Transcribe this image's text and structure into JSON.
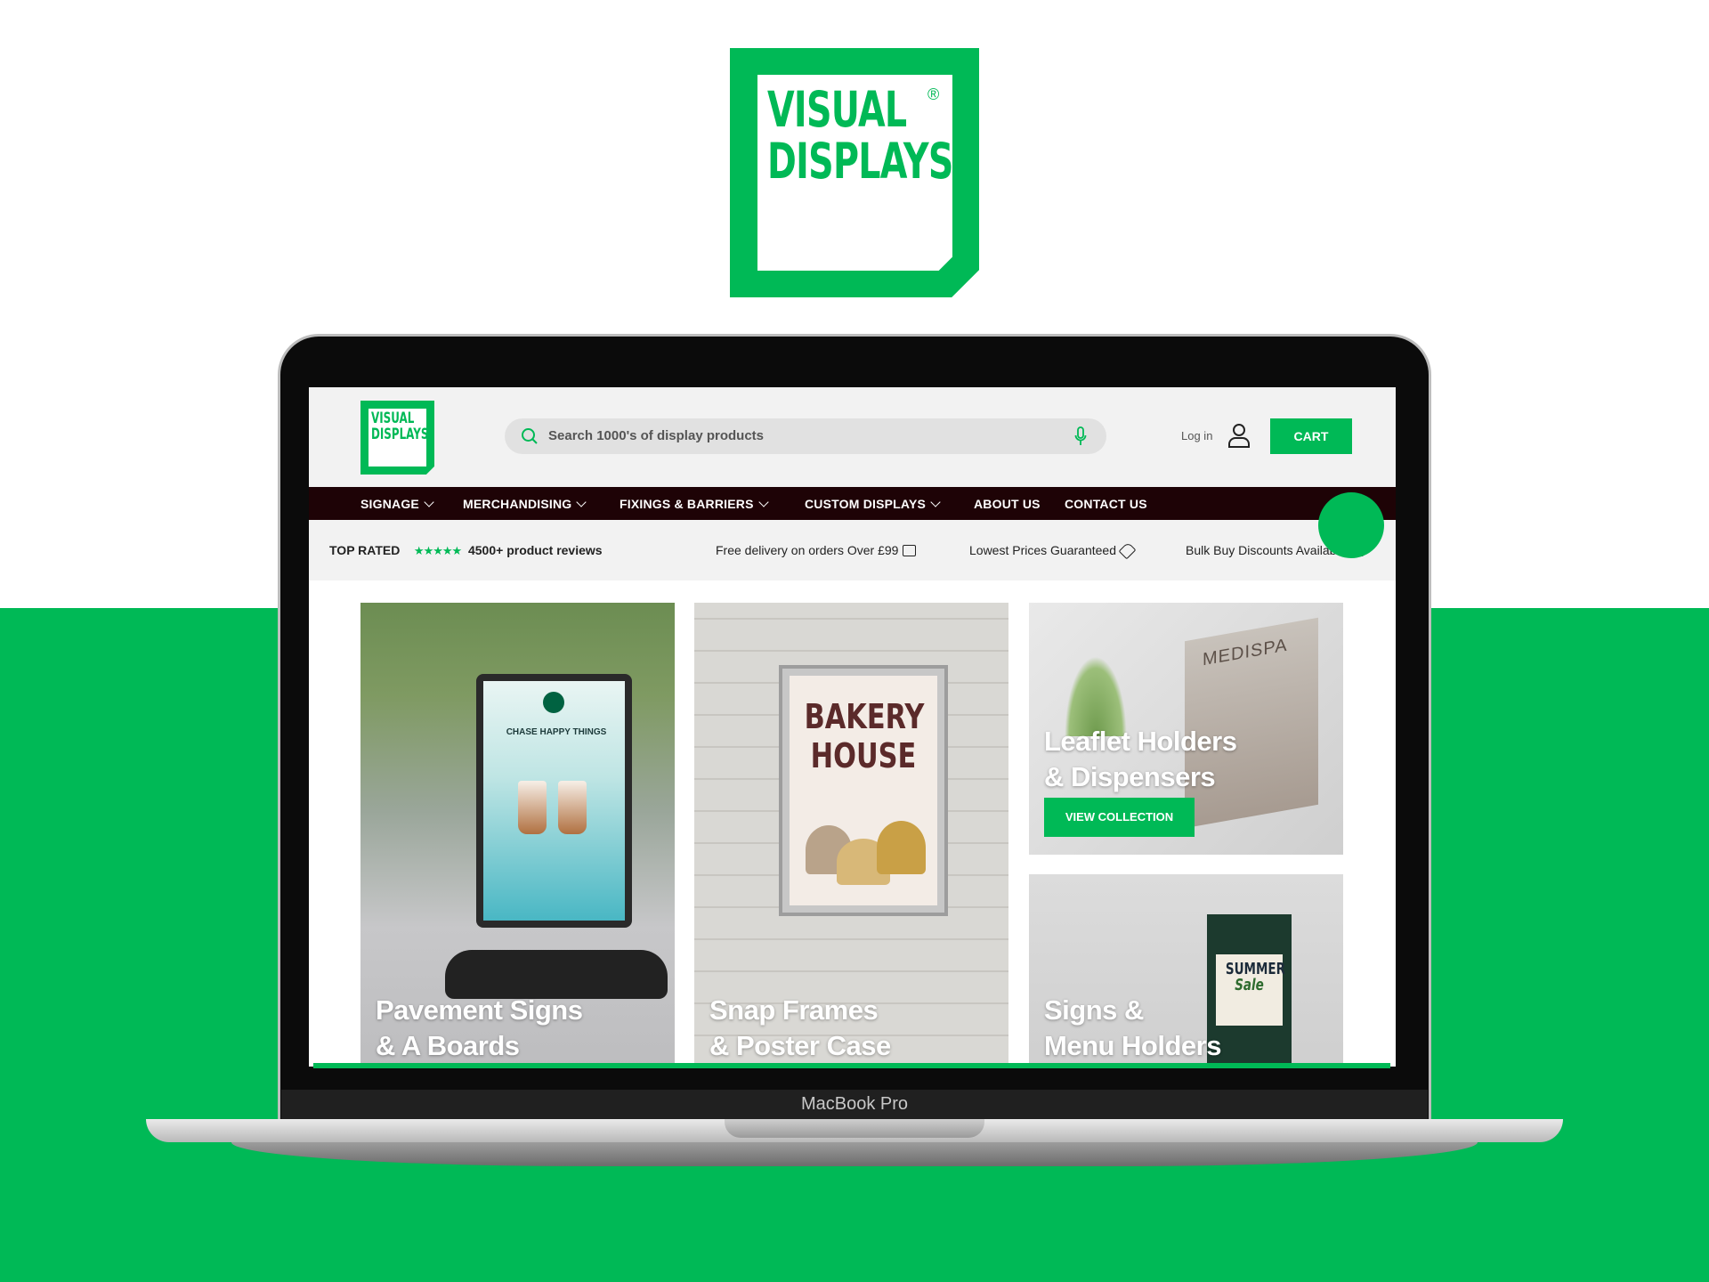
{
  "brand": {
    "logo_line1": "VISUAL",
    "logo_line2": "DISPLAYS",
    "registered_mark": "®",
    "accent_color": "#00b956",
    "nav_color": "#1e0306"
  },
  "device": {
    "label": "MacBook Pro"
  },
  "header": {
    "search": {
      "placeholder": "Search 1000's of display products",
      "icon": "search-icon",
      "voice_icon": "microphone-icon"
    },
    "login_label": "Log in",
    "account_icon": "user-icon",
    "cart_label": "CART"
  },
  "nav": {
    "items": [
      {
        "label": "SIGNAGE",
        "has_dropdown": true
      },
      {
        "label": "MERCHANDISING",
        "has_dropdown": true
      },
      {
        "label": "FIXINGS & BARRIERS",
        "has_dropdown": true
      },
      {
        "label": "CUSTOM DISPLAYS",
        "has_dropdown": true
      },
      {
        "label": "ABOUT US",
        "has_dropdown": false
      },
      {
        "label": "CONTACT US",
        "has_dropdown": false
      }
    ]
  },
  "usp_strip": {
    "top_rated": "TOP RATED",
    "stars": "★★★★★",
    "reviews": "4500+ product reviews",
    "delivery": "Free delivery on orders Over £99",
    "price": "Lowest Prices Guaranteed",
    "bulk": "Bulk Buy Discounts Available"
  },
  "tiles": {
    "pavement": {
      "line1": "Pavement Signs",
      "line2": "& A Boards",
      "poster_text": "CHASE HAPPY THINGS"
    },
    "snap": {
      "line1": "Snap Frames",
      "line2": "& Poster Case",
      "poster_line1": "BAKERY",
      "poster_line2": "HOUSE"
    },
    "leaflet": {
      "line1": "Leaflet Holders",
      "line2": "& Dispensers",
      "button": "VIEW COLLECTION",
      "brochure_text": "MEDISPA"
    },
    "signs": {
      "line1": "Signs &",
      "line2": "Menu Holders",
      "poster_line1": "SUMMER",
      "poster_line2": "Sale"
    }
  }
}
